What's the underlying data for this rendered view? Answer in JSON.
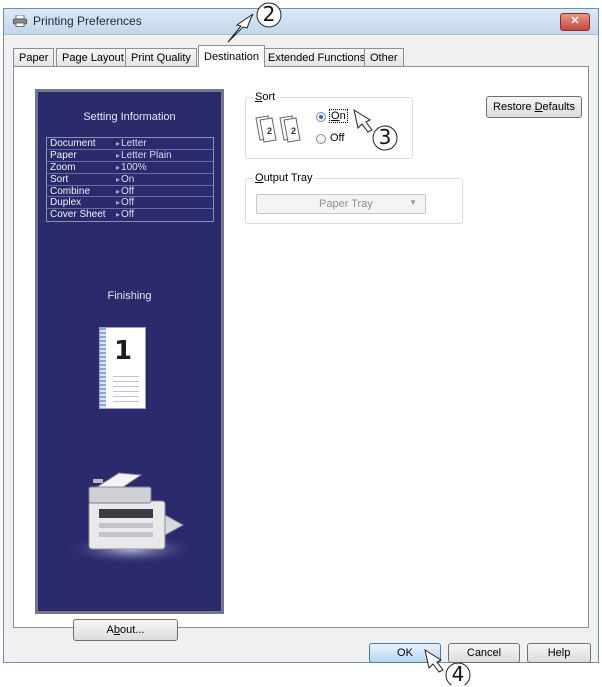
{
  "window": {
    "title": "Printing Preferences",
    "close_label": "✕"
  },
  "tabs": [
    {
      "label": "Paper"
    },
    {
      "label": "Page Layout"
    },
    {
      "label": "Print Quality"
    },
    {
      "label": "Destination",
      "active": true
    },
    {
      "label": "Extended Functions"
    },
    {
      "label": "Other"
    }
  ],
  "setting_info": {
    "title": "Setting Information",
    "rows": [
      {
        "key": "Document",
        "value": "Letter"
      },
      {
        "key": "Paper",
        "value": "Letter Plain"
      },
      {
        "key": "Zoom",
        "value": "100%"
      },
      {
        "key": "Sort",
        "value": "On"
      },
      {
        "key": "Combine",
        "value": "Off"
      },
      {
        "key": "Duplex",
        "value": "Off"
      },
      {
        "key": "Cover Sheet",
        "value": "Off"
      }
    ],
    "finishing_label": "Finishing",
    "page_number": "1"
  },
  "about_button": {
    "label_pre": "A",
    "label_u": "b",
    "label_post": "out..."
  },
  "sort": {
    "legend_u": "S",
    "legend_rest": "ort",
    "on_u": "O",
    "on_rest": "n",
    "off_label": "Off",
    "selected": "On"
  },
  "output_tray": {
    "legend_u": "O",
    "legend_rest": "utput Tray",
    "value": "Paper Tray"
  },
  "restore_button": {
    "label_pre": "Restore ",
    "label_u": "D",
    "label_post": "efaults"
  },
  "footer": {
    "ok_label": "OK",
    "cancel_label": "Cancel",
    "help_label": "Help"
  },
  "callouts": [
    "2",
    "3",
    "4"
  ],
  "colors": {
    "info_panel_bg": "#2b2a6c",
    "radio_accent": "#2a6bc4",
    "default_button_border": "#3c7fb1"
  }
}
